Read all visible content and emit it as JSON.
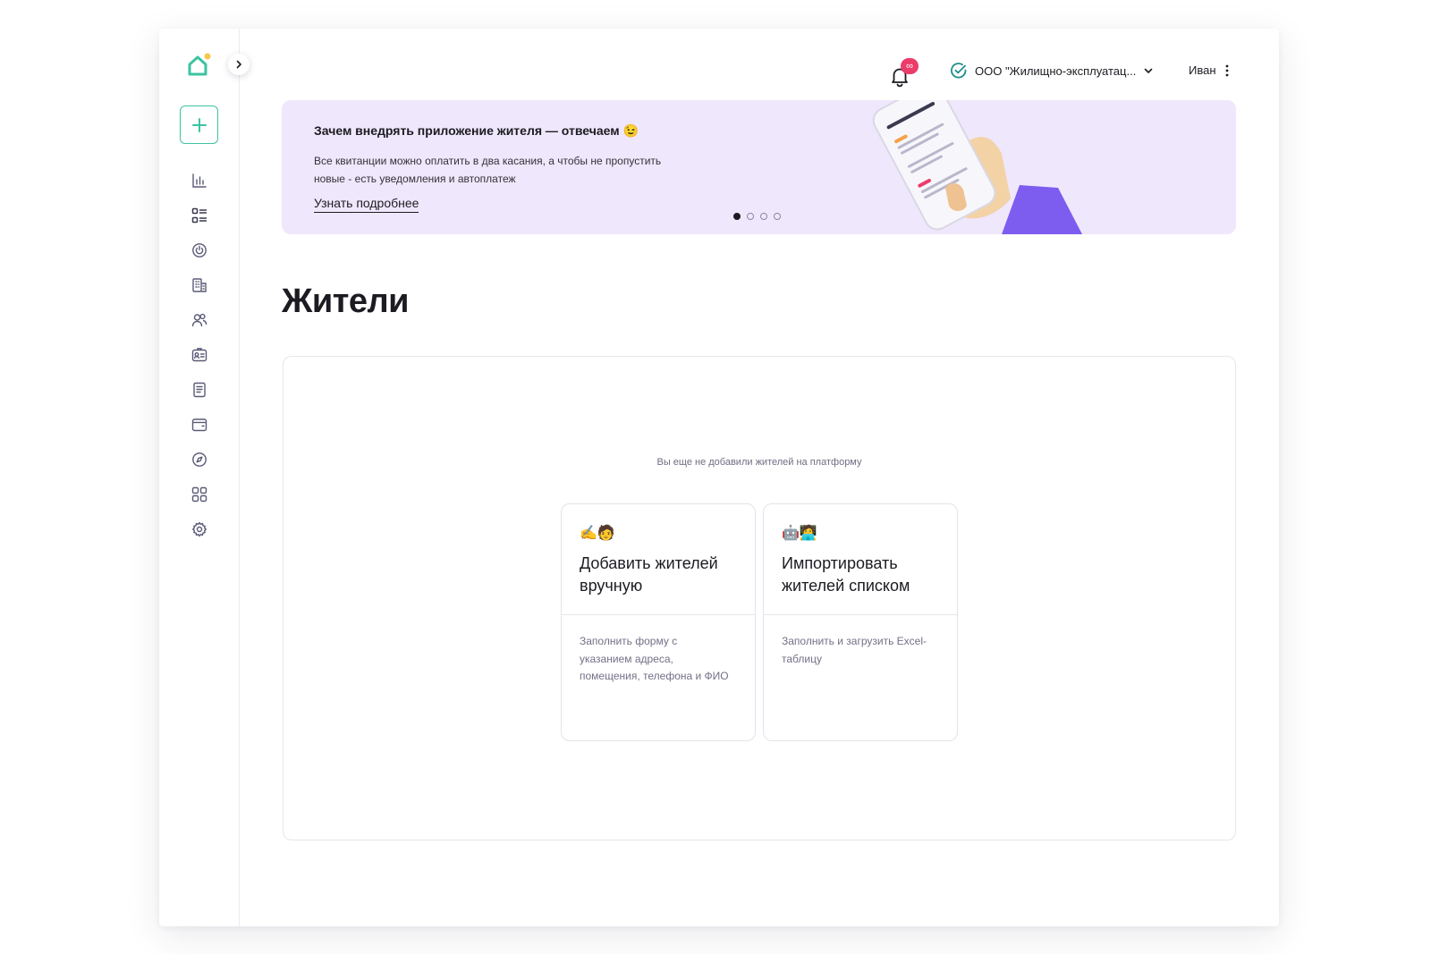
{
  "header": {
    "notifications_badge": "∞",
    "org_name": "ООО \"Жилищно-эксплуатац...",
    "user_name": "Иван"
  },
  "sidebar": {
    "items": [
      {
        "icon": "bar-chart-icon"
      },
      {
        "icon": "list-grid-icon"
      },
      {
        "icon": "power-circle-icon"
      },
      {
        "icon": "building-icon"
      },
      {
        "icon": "users-icon"
      },
      {
        "icon": "id-card-icon"
      },
      {
        "icon": "document-icon"
      },
      {
        "icon": "wallet-icon"
      },
      {
        "icon": "compass-icon"
      },
      {
        "icon": "apps-grid-icon"
      },
      {
        "icon": "settings-gear-icon"
      }
    ]
  },
  "banner": {
    "title": "Зачем внедрять приложение жителя — отвечаем 😉",
    "text": "Все квитанции можно оплатить в два касания, а чтобы не пропустить новые - есть уведомления и автоплатеж",
    "link": "Узнать подробнее",
    "slides_total": 4,
    "active_slide": 1
  },
  "page": {
    "title": "Жители"
  },
  "empty_state": {
    "text": "Вы еще не добавили жителей на платформу",
    "cards": [
      {
        "emoji": "✍️🧑",
        "title": "Добавить жителей вручную",
        "description": "Заполнить форму с указанием адреса, помещения, телефона и ФИО"
      },
      {
        "emoji": "🤖🧑‍💻",
        "title": "Импортировать жителей списком",
        "description": "Заполнить и загрузить Excel-таблицу"
      }
    ]
  },
  "colors": {
    "accent": "#3cc3a2",
    "banner_bg": "#efe7fb",
    "badge": "#ec3c6a",
    "brand_purple": "#7d5cf0"
  }
}
